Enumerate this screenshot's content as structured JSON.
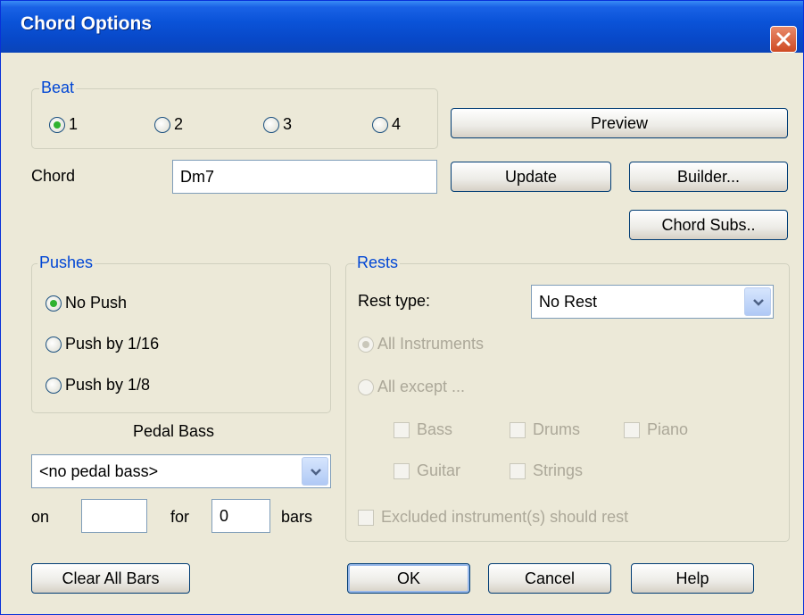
{
  "window": {
    "title": "Chord Options"
  },
  "beat": {
    "legend": "Beat",
    "options": [
      "1",
      "2",
      "3",
      "4"
    ],
    "selected": "1"
  },
  "chord": {
    "label": "Chord",
    "value": "Dm7"
  },
  "buttons": {
    "preview": "Preview",
    "update": "Update",
    "builder": "Builder...",
    "chord_subs": "Chord Subs..",
    "clear_all_bars": "Clear All Bars",
    "ok": "OK",
    "cancel": "Cancel",
    "help": "Help"
  },
  "pushes": {
    "legend": "Pushes",
    "options": [
      "No Push",
      "Push by 1/16",
      "Push by 1/8"
    ],
    "selected": "No Push"
  },
  "pedal_bass": {
    "heading": "Pedal Bass",
    "selected": "<no pedal bass>",
    "on_label": "on",
    "on_value": "",
    "for_label": "for",
    "for_value": "0",
    "bars_label": "bars"
  },
  "rests": {
    "legend": "Rests",
    "rest_type_label": "Rest type:",
    "rest_type_value": "No Rest",
    "options": [
      "All Instruments",
      "All except ..."
    ],
    "selected": "All Instruments",
    "instruments": [
      "Bass",
      "Drums",
      "Piano",
      "Guitar",
      "Strings"
    ],
    "excluded_label": "Excluded instrument(s) should rest"
  },
  "colors": {
    "titlebar": "#0a53d8",
    "dialog_bg": "#ece9d8",
    "legend": "#0046d5",
    "radio_dot": "#2fb22f",
    "disabled": "#aca899"
  }
}
